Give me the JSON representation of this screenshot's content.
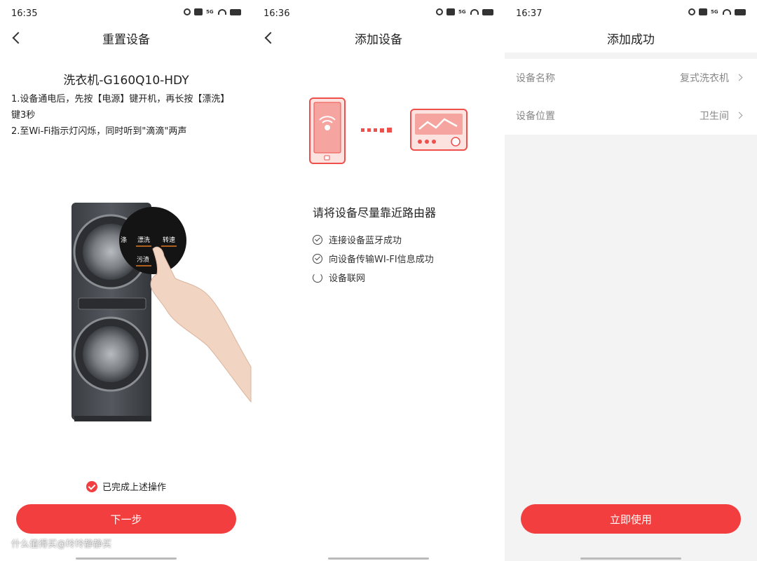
{
  "accent": "#f23e3e",
  "screen1": {
    "status_time": "16:35",
    "title": "重置设备",
    "device_model": "洗衣机-G160Q10-HDY",
    "instruction_1a": "1.设备通电后，先按【电源】键开机，再长按【漂洗】",
    "instruction_1b": "键3秒",
    "instruction_2": "2.至Wi-Fi指示灯闪烁，同时听到\"滴滴\"两声",
    "panel_labels": [
      "漂洗",
      "转速",
      "污渍",
      "涤"
    ],
    "confirm_label": "已完成上述操作",
    "next_button": "下一步",
    "watermark": "什么值得买@玲玲静静买"
  },
  "screen2": {
    "status_time": "16:36",
    "title": "添加设备",
    "heading": "请将设备尽量靠近路由器",
    "steps": [
      {
        "label": "连接设备蓝牙成功",
        "state": "done"
      },
      {
        "label": "向设备传输WI-FI信息成功",
        "state": "done"
      },
      {
        "label": "设备联网",
        "state": "loading"
      }
    ]
  },
  "screen3": {
    "status_time": "16:37",
    "title": "添加成功",
    "rows": [
      {
        "label": "设备名称",
        "value": "复式洗衣机"
      },
      {
        "label": "设备位置",
        "value": "卫生间"
      }
    ],
    "use_button": "立即使用"
  }
}
